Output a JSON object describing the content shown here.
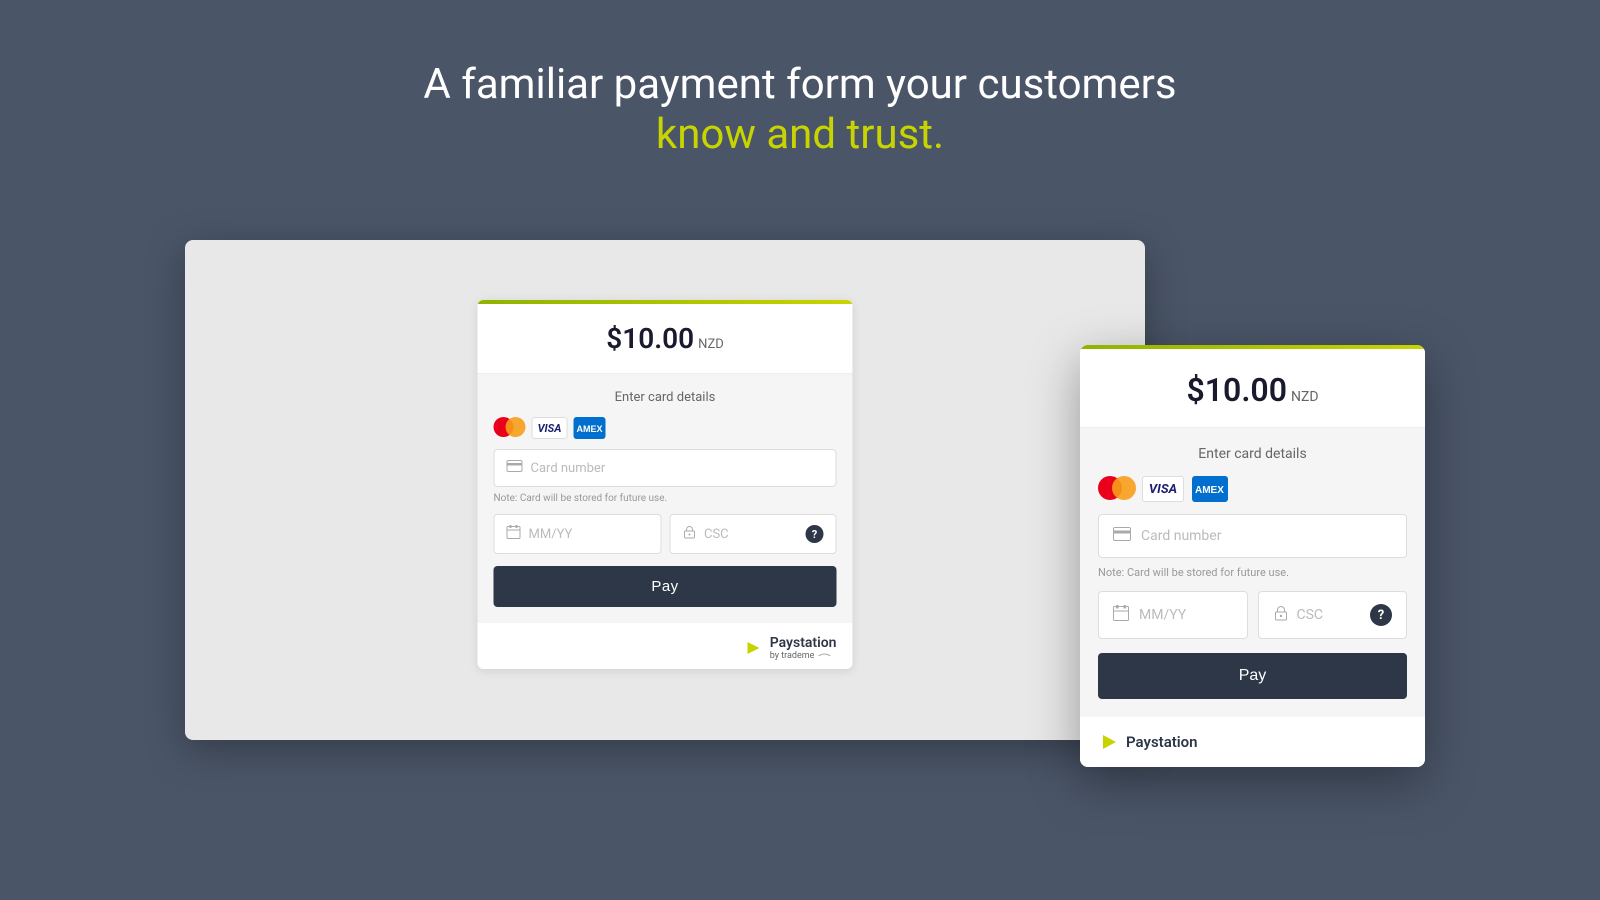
{
  "page": {
    "background_color": "#4a5568"
  },
  "hero": {
    "title_white": "A familiar payment form your customers",
    "title_green": "know and trust.",
    "title_green_color": "#c8d400"
  },
  "desktop_form": {
    "amount": "$10.00",
    "currency": "NZD",
    "section_title": "Enter card details",
    "card_number_placeholder": "Card number",
    "note_text": "Note: Card will be stored for future use.",
    "expiry_placeholder": "MM/YY",
    "csc_placeholder": "CSC",
    "pay_button_label": "Pay"
  },
  "mobile_form": {
    "amount": "$10.00",
    "currency": "NZD",
    "section_title": "Enter card details",
    "card_number_placeholder": "Card number",
    "note_text": "Note: Card will be stored for future use.",
    "expiry_placeholder": "MM/YY",
    "csc_placeholder": "CSC",
    "pay_button_label": "Pay"
  },
  "paystation": {
    "name": "Paystation",
    "sub": "by trademe",
    "tagline": "Paystation"
  },
  "icons": {
    "mastercard": "mastercard-icon",
    "visa": "visa-icon",
    "amex": "amex-icon",
    "card": "💳",
    "calendar": "📅",
    "lock": "🔒",
    "help": "?"
  }
}
